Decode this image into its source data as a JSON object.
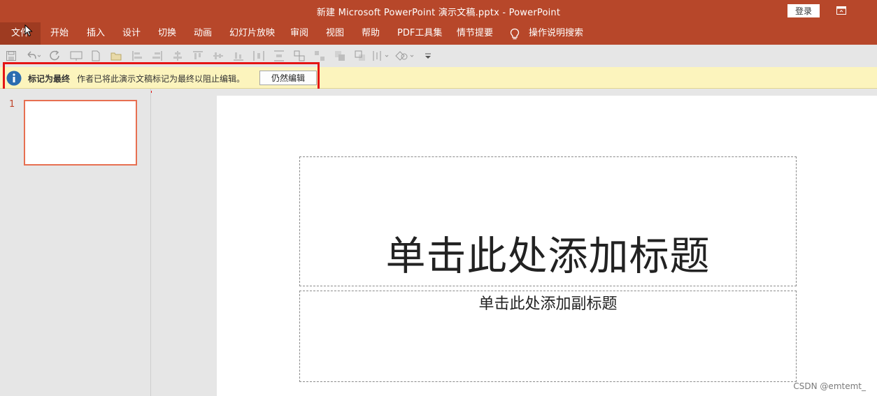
{
  "window": {
    "title": "新建 Microsoft PowerPoint 演示文稿.pptx  -  PowerPoint",
    "login_label": "登录"
  },
  "ribbon": {
    "tabs": [
      {
        "label": "文件"
      },
      {
        "label": "开始"
      },
      {
        "label": "插入"
      },
      {
        "label": "设计"
      },
      {
        "label": "切换"
      },
      {
        "label": "动画"
      },
      {
        "label": "幻灯片放映"
      },
      {
        "label": "审阅"
      },
      {
        "label": "视图"
      },
      {
        "label": "帮助"
      },
      {
        "label": "PDF工具集"
      },
      {
        "label": "情节提要"
      }
    ],
    "tell_me": "操作说明搜索"
  },
  "message_bar": {
    "title": "标记为最终",
    "text": "作者已将此演示文稿标记为最终以阻止编辑。",
    "button_label": "仍然编辑"
  },
  "thumbnails": {
    "slide_number": "1"
  },
  "slide": {
    "title_placeholder": "单击此处添加标题",
    "subtitle_placeholder": "单击此处添加副标题"
  },
  "watermark": "CSDN @emtemt_",
  "colors": {
    "ribbon": "#b7472a",
    "highlight": "#e41414",
    "message_bar": "#fcf4bd",
    "thumb_border": "#e76f51"
  }
}
